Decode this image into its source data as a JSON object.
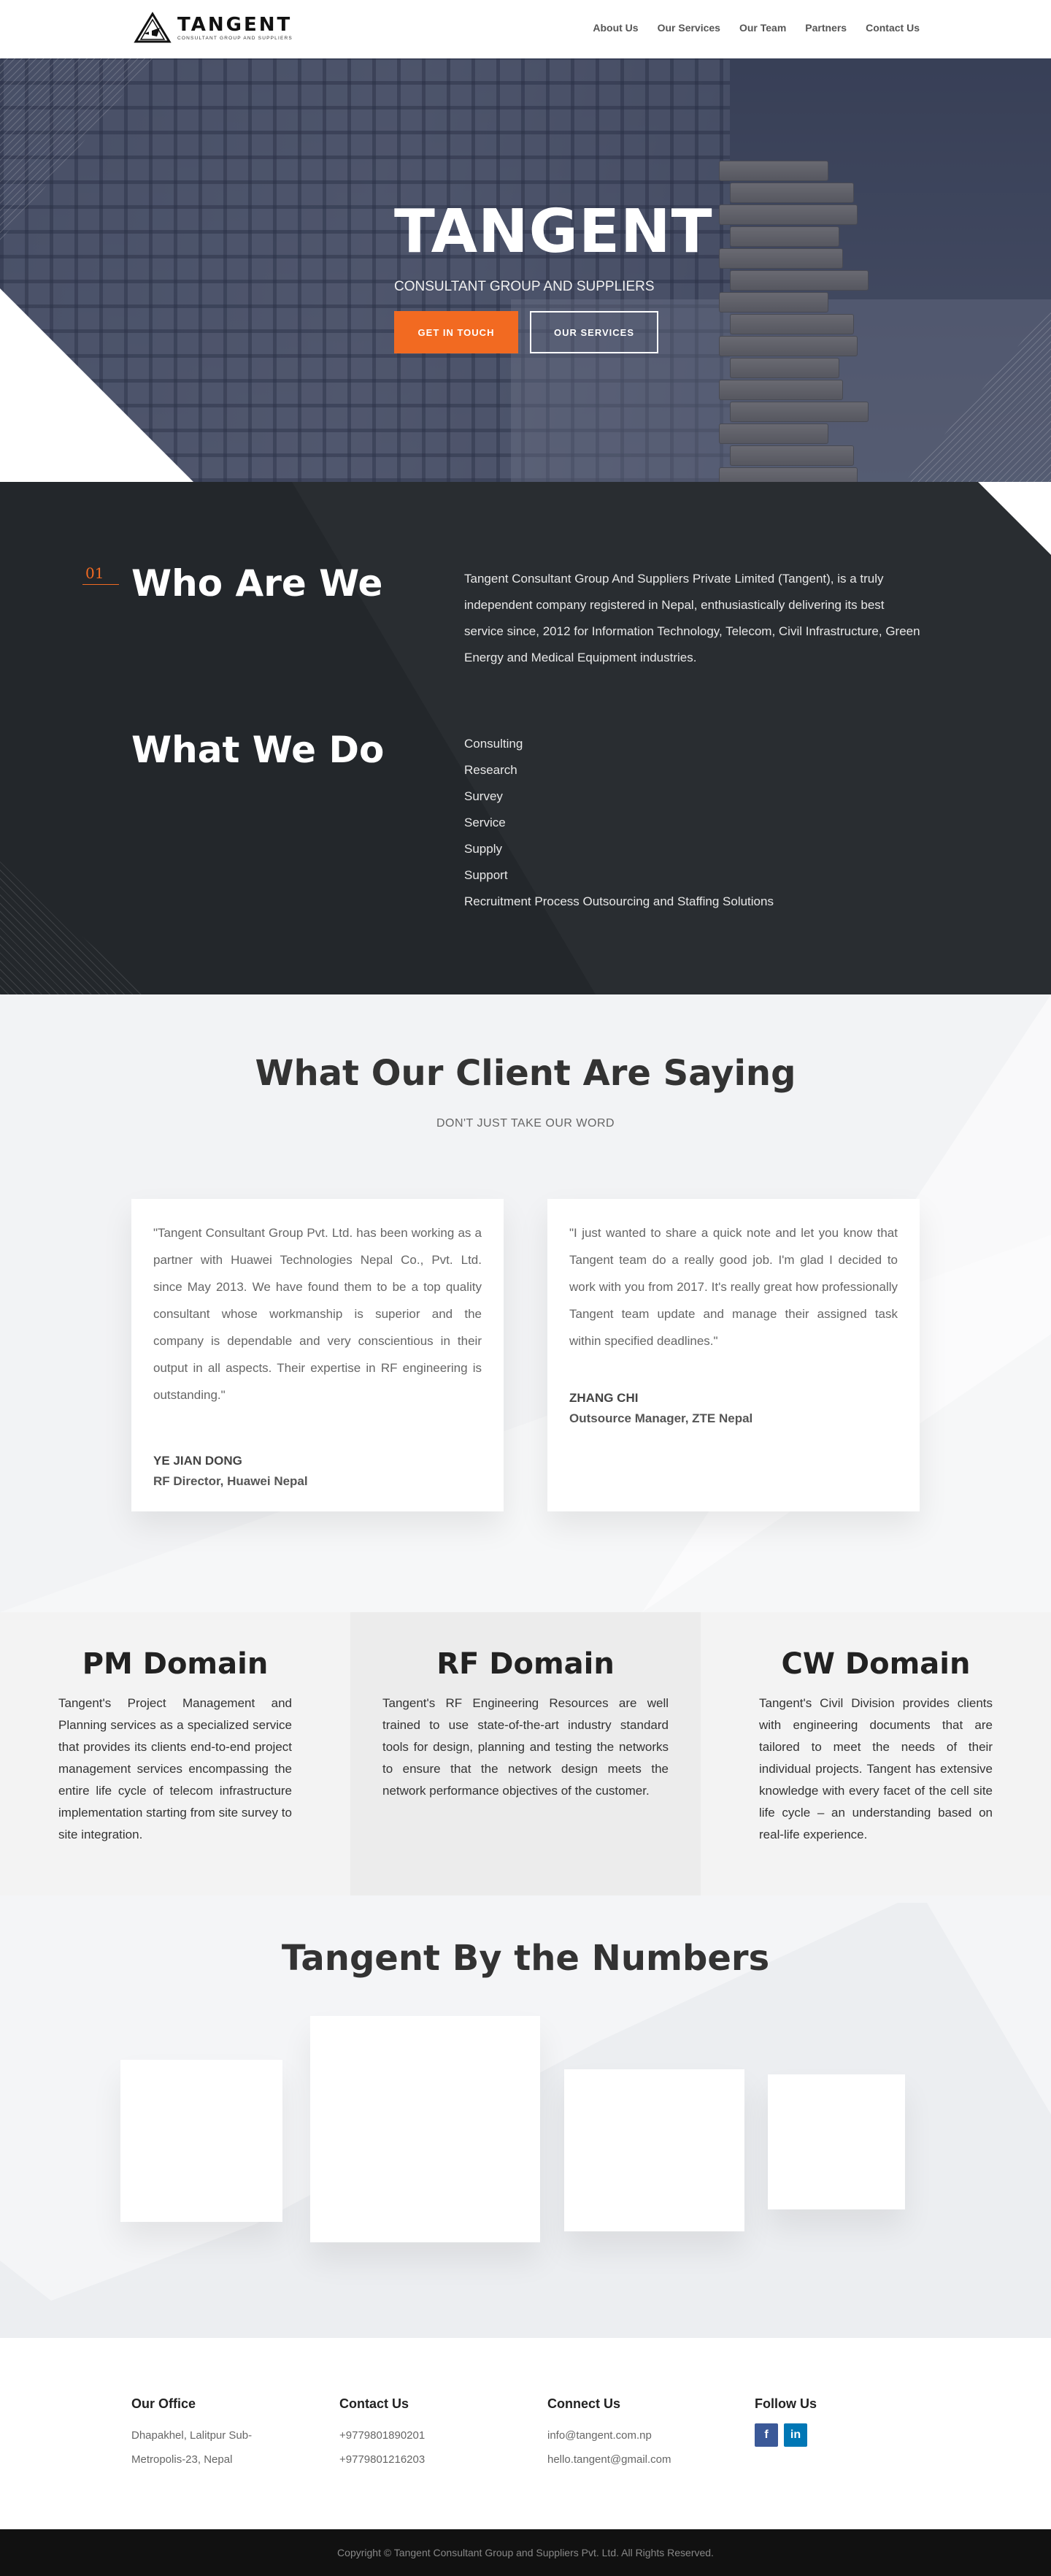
{
  "header": {
    "logo_name": "TANGENT",
    "logo_tagline": "CONSULTANT GROUP AND SUPPLIERS",
    "nav": [
      "About Us",
      "Our Services",
      "Our Team",
      "Partners",
      "Contact Us"
    ]
  },
  "hero": {
    "title": "TANGENT",
    "subtitle": "CONSULTANT GROUP AND SUPPLIERS",
    "btn_primary": "GET IN TOUCH",
    "btn_secondary": "OUR SERVICES"
  },
  "about": {
    "number": "01",
    "who_title": "Who Are We",
    "who_text": "Tangent Consultant Group And Suppliers Private Limited (Tangent), is a truly independent company registered in Nepal, enthusiastically delivering its best service since, 2012 for Information Technology, Telecom, Civil Infrastructure, Green Energy and Medical Equipment industries.",
    "what_title": "What We Do",
    "what_items": [
      "Consulting",
      "Research",
      "Survey",
      "Service",
      "Supply",
      "Support",
      "Recruitment Process Outsourcing and Staffing Solutions"
    ]
  },
  "testimonials": {
    "title": "What Our Client Are Saying",
    "subtitle": "DON'T JUST TAKE OUR WORD",
    "items": [
      {
        "quote": "\"Tangent Consultant Group Pvt. Ltd. has been working as a partner with Huawei Technologies Nepal Co., Pvt. Ltd. since May 2013. We have found them to be a top quality consultant whose workmanship is superior and the company is dependable and very conscientious in their output in all aspects. Their expertise in RF engineering is outstanding.\"",
        "name": "YE JIAN DONG",
        "role": "RF Director, Huawei Nepal"
      },
      {
        "quote": "\"I just wanted to share a quick note and let you know that Tangent team do a really good job. I'm glad I decided to work with you from 2017. It's really great how professionally Tangent team update and manage their assigned task within specified deadlines.\"",
        "name": "ZHANG CHI",
        "role": "Outsource Manager, ZTE Nepal"
      }
    ]
  },
  "domains": [
    {
      "title": "PM Domain",
      "text": "Tangent's Project Management and Planning services as a specialized service that provides its clients end-to-end project management services encompassing the entire life cycle of telecom infrastructure implementation starting from site survey to site integration."
    },
    {
      "title": "RF Domain",
      "text": "Tangent's RF Engineering Resources are well trained to use state-of-the-art industry standard tools for design, planning and testing the networks to ensure that the network design meets the network performance objectives of the customer."
    },
    {
      "title": "CW Domain",
      "text": "Tangent's Civil Division provides clients with engineering documents that are tailored to meet the needs of their individual projects. Tangent has extensive knowledge with every facet of the cell site life cycle – an understanding based on real-life experience."
    }
  ],
  "numbers": {
    "title": "Tangent By the Numbers"
  },
  "footer": {
    "office_title": "Our Office",
    "office_lines": [
      "Dhapakhel, Lalitpur Sub-",
      "Metropolis-23, Nepal"
    ],
    "contact_title": "Contact Us",
    "contact_lines": [
      "+9779801890201",
      "+9779801216203"
    ],
    "connect_title": "Connect Us",
    "connect_lines": [
      "info@tangent.com.np",
      "hello.tangent@gmail.com"
    ],
    "follow_title": "Follow Us",
    "social": [
      {
        "icon": "facebook-icon",
        "glyph": "f"
      },
      {
        "icon": "linkedin-icon",
        "glyph": "in"
      }
    ],
    "copyright": "Copyright © Tangent Consultant Group and Suppliers Pvt. Ltd. All Rights Reserved."
  },
  "colors": {
    "accent": "#f26a21",
    "dark": "#23272b",
    "facebook": "#3b5998",
    "linkedin": "#0077b5"
  }
}
